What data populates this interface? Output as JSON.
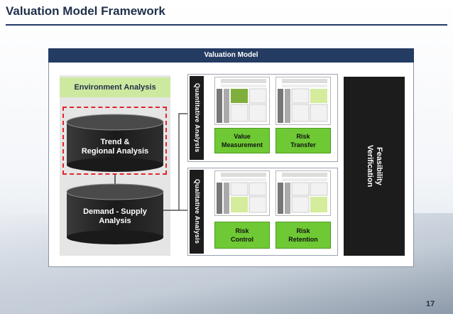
{
  "title": "Valuation Model Framework",
  "page_number": "17",
  "header": "Valuation Model",
  "environment": {
    "label": "Environment Analysis",
    "trend": "Trend &\nRegional Analysis",
    "demand": "Demand - Supply\nAnalysis"
  },
  "quantitative": {
    "label": "Quantitative Analysis",
    "value": "Value\nMeasurement",
    "transfer": "Risk\nTransfer"
  },
  "qualitative": {
    "label": "Qualitative Analysis",
    "control": "Risk\nControl",
    "retention": "Risk\nRetention"
  },
  "feasibility": "Feasibility\nVerification",
  "colors": {
    "navy": "#243b62",
    "accent_green": "#6fc934",
    "light_green": "#cde9a0",
    "dark": "#1c1c1c",
    "red_dash": "#e1262c"
  }
}
